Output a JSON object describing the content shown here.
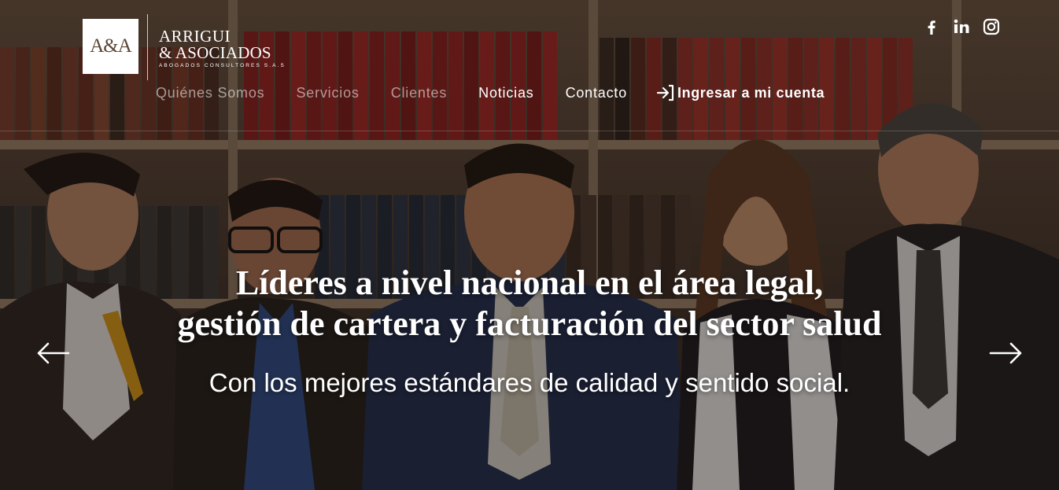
{
  "brand": {
    "logo_mark": "A&A",
    "name_line1": "ARRIGUI",
    "name_line2": "& ASOCIADOS",
    "tagline": "ABOGADOS CONSULTORES S.A.S"
  },
  "nav": {
    "items": [
      {
        "label": "Quiénes Somos",
        "active": false
      },
      {
        "label": "Servicios",
        "active": false
      },
      {
        "label": "Clientes",
        "active": false
      },
      {
        "label": "Noticias",
        "active": true
      },
      {
        "label": "Contacto",
        "active": true
      }
    ],
    "login_label": "Ingresar a mi cuenta",
    "login_icon": "sign-in-icon"
  },
  "social": [
    "facebook-icon",
    "linkedin-icon",
    "instagram-icon"
  ],
  "hero": {
    "title_line1": "Líderes a nivel nacional en el área legal,",
    "title_line2": "gestión de cartera y facturación del sector salud",
    "subtitle": "Con los mejores estándares de calidad y sentido social.",
    "prev_icon": "arrow-left-icon",
    "next_icon": "arrow-right-icon"
  },
  "colors": {
    "text": "#ffffff",
    "nav_muted": "rgba(255,255,255,0.55)",
    "logo_brown": "#5a4636"
  }
}
